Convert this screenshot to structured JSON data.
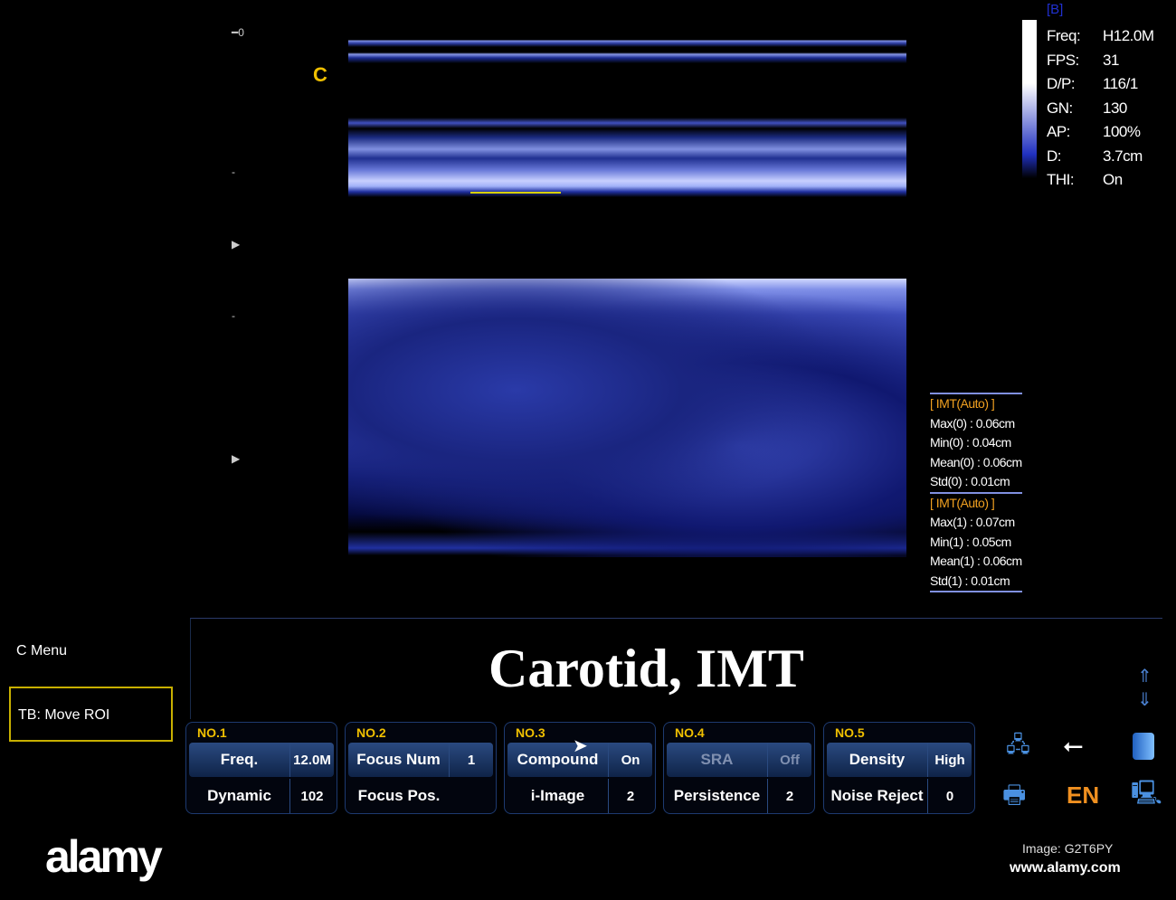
{
  "scan": {
    "mode_label": "[B]",
    "depth_top": "0",
    "view_marker": "C",
    "params": [
      {
        "k": "Freq:",
        "v": "H12.0M"
      },
      {
        "k": "FPS:",
        "v": "31"
      },
      {
        "k": "D/P:",
        "v": "116/1"
      },
      {
        "k": "GN:",
        "v": "130"
      },
      {
        "k": "AP:",
        "v": "100%"
      },
      {
        "k": "D:",
        "v": "3.7cm"
      },
      {
        "k": "THI:",
        "v": "On"
      }
    ]
  },
  "imt": [
    {
      "header": "[ IMT(Auto) ]",
      "max": "Max(0) : 0.06cm",
      "min": "Min(0) : 0.04cm",
      "mean": "Mean(0) : 0.06cm",
      "std": "Std(0) : 0.01cm"
    },
    {
      "header": "[ IMT(Auto) ]",
      "max": "Max(1) : 0.07cm",
      "min": "Min(1) : 0.05cm",
      "mean": "Mean(1) : 0.06cm",
      "std": "Std(1) : 0.01cm"
    }
  ],
  "menu": {
    "c_menu": "C Menu",
    "tb": "TB: Move ROI"
  },
  "title": "Carotid, IMT",
  "panels": [
    {
      "no": "NO.1",
      "r1l": "Freq.",
      "r1v": "12.0M",
      "r2l": "Dynamic",
      "r2v": "102"
    },
    {
      "no": "NO.2",
      "r1l": "Focus Num",
      "r1v": "1",
      "r2l": "Focus Pos.",
      "r2v": ""
    },
    {
      "no": "NO.3",
      "r1l": "Compound",
      "r1v": "On",
      "r2l": "i-Image",
      "r2v": "2"
    },
    {
      "no": "NO.4",
      "r1l": "SRA",
      "r1v": "Off",
      "r2l": "Persistence",
      "r2v": "2"
    },
    {
      "no": "NO.5",
      "r1l": "Density",
      "r1v": "High",
      "r2l": "Noise Reject",
      "r2v": "0"
    }
  ],
  "status": {
    "language": "EN"
  },
  "watermark": {
    "logo": "alamy",
    "image_id": "Image: G2T6PY",
    "site": "www.alamy.com"
  },
  "colors": {
    "accent": "#f0c000",
    "ultrasound": "#4050c0"
  }
}
